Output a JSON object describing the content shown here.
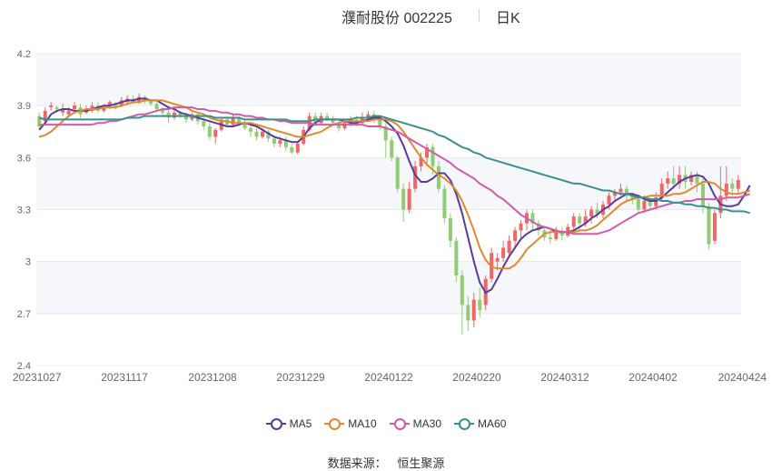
{
  "header": {
    "title": "濮耐股份 002225",
    "period": "日K"
  },
  "colors": {
    "up": "#ee6666",
    "down": "#91cc75",
    "grid_band": "#f5f7fb"
  },
  "chart_data": {
    "type": "candlestick",
    "y_ticks": [
      "4.2",
      "3.9",
      "3.6",
      "3.3",
      "3",
      "2.7",
      "2.4"
    ],
    "ylim": [
      2.4,
      4.2
    ],
    "x_ticks": [
      "20231027",
      "20231117",
      "20231208",
      "20231229",
      "20240122",
      "20240220",
      "20240312",
      "20240402",
      "20240424"
    ],
    "grid": true,
    "legend_position": "bottom",
    "series": [
      {
        "name": "MA5",
        "color": "#5a3a9e",
        "values": [
          3.76,
          3.8,
          3.85,
          3.87,
          3.88,
          3.88,
          3.87,
          3.87,
          3.87,
          3.88,
          3.89,
          3.9,
          3.9,
          3.91,
          3.92,
          3.93,
          3.93,
          3.94,
          3.94,
          3.93,
          3.93,
          3.91,
          3.89,
          3.88,
          3.86,
          3.85,
          3.84,
          3.83,
          3.82,
          3.81,
          3.8,
          3.79,
          3.78,
          3.78,
          3.79,
          3.8,
          3.79,
          3.78,
          3.76,
          3.74,
          3.72,
          3.71,
          3.7,
          3.69,
          3.69,
          3.72,
          3.77,
          3.8,
          3.82,
          3.82,
          3.82,
          3.82,
          3.81,
          3.8,
          3.8,
          3.81,
          3.82,
          3.83,
          3.83,
          3.81,
          3.78,
          3.74,
          3.67,
          3.58,
          3.5,
          3.46,
          3.46,
          3.48,
          3.51,
          3.51,
          3.47,
          3.39,
          3.28,
          3.14,
          3.0,
          2.88,
          2.82,
          2.84,
          2.9,
          2.97,
          3.03,
          3.08,
          3.13,
          3.16,
          3.18,
          3.19,
          3.2,
          3.19,
          3.17,
          3.17,
          3.17,
          3.18,
          3.2,
          3.22,
          3.25,
          3.27,
          3.3,
          3.32,
          3.35,
          3.37,
          3.39,
          3.39,
          3.38,
          3.36,
          3.35,
          3.35,
          3.37,
          3.4,
          3.43,
          3.46,
          3.48,
          3.49,
          3.5,
          3.49,
          3.45,
          3.38,
          3.33,
          3.32,
          3.32,
          3.33,
          3.38,
          3.44
        ]
      },
      {
        "name": "MA10",
        "color": "#e08a2e",
        "values": [
          3.72,
          3.73,
          3.75,
          3.78,
          3.81,
          3.84,
          3.86,
          3.87,
          3.88,
          3.88,
          3.88,
          3.89,
          3.89,
          3.89,
          3.9,
          3.91,
          3.92,
          3.92,
          3.93,
          3.93,
          3.93,
          3.93,
          3.92,
          3.91,
          3.9,
          3.89,
          3.87,
          3.86,
          3.85,
          3.83,
          3.82,
          3.81,
          3.81,
          3.8,
          3.8,
          3.8,
          3.8,
          3.79,
          3.78,
          3.77,
          3.76,
          3.75,
          3.74,
          3.73,
          3.72,
          3.72,
          3.73,
          3.74,
          3.75,
          3.77,
          3.79,
          3.8,
          3.81,
          3.81,
          3.81,
          3.81,
          3.81,
          3.82,
          3.82,
          3.82,
          3.81,
          3.79,
          3.75,
          3.7,
          3.65,
          3.6,
          3.56,
          3.53,
          3.5,
          3.48,
          3.45,
          3.41,
          3.35,
          3.27,
          3.18,
          3.08,
          3.01,
          2.97,
          2.96,
          2.96,
          2.96,
          2.98,
          3.02,
          3.07,
          3.1,
          3.13,
          3.16,
          3.17,
          3.17,
          3.17,
          3.17,
          3.17,
          3.18,
          3.18,
          3.19,
          3.21,
          3.24,
          3.27,
          3.3,
          3.33,
          3.35,
          3.36,
          3.37,
          3.37,
          3.38,
          3.38,
          3.38,
          3.38,
          3.39,
          3.39,
          3.4,
          3.42,
          3.44,
          3.46,
          3.46,
          3.45,
          3.42,
          3.4,
          3.39,
          3.39,
          3.4,
          3.41
        ]
      },
      {
        "name": "MA30",
        "color": "#d45aa8",
        "values": [
          3.79,
          3.79,
          3.79,
          3.79,
          3.79,
          3.79,
          3.79,
          3.79,
          3.79,
          3.79,
          3.8,
          3.8,
          3.81,
          3.81,
          3.82,
          3.83,
          3.84,
          3.85,
          3.85,
          3.86,
          3.87,
          3.88,
          3.88,
          3.89,
          3.89,
          3.89,
          3.89,
          3.88,
          3.88,
          3.87,
          3.87,
          3.86,
          3.86,
          3.85,
          3.85,
          3.84,
          3.84,
          3.83,
          3.83,
          3.82,
          3.82,
          3.81,
          3.81,
          3.8,
          3.8,
          3.8,
          3.8,
          3.79,
          3.79,
          3.79,
          3.79,
          3.79,
          3.79,
          3.79,
          3.79,
          3.79,
          3.78,
          3.78,
          3.78,
          3.77,
          3.76,
          3.75,
          3.73,
          3.71,
          3.69,
          3.67,
          3.65,
          3.63,
          3.61,
          3.59,
          3.57,
          3.54,
          3.52,
          3.5,
          3.48,
          3.45,
          3.43,
          3.41,
          3.38,
          3.36,
          3.33,
          3.3,
          3.27,
          3.25,
          3.23,
          3.21,
          3.2,
          3.19,
          3.18,
          3.17,
          3.17,
          3.16,
          3.16,
          3.16,
          3.16,
          3.16,
          3.17,
          3.18,
          3.2,
          3.22,
          3.24,
          3.26,
          3.28,
          3.29,
          3.3,
          3.31,
          3.32,
          3.33,
          3.34,
          3.34,
          3.35,
          3.35,
          3.36,
          3.36,
          3.36,
          3.36,
          3.36,
          3.37,
          3.37,
          3.37,
          3.38,
          3.39
        ]
      },
      {
        "name": "MA60",
        "color": "#3a9090",
        "values": [
          3.83,
          3.82,
          3.82,
          3.82,
          3.82,
          3.82,
          3.82,
          3.82,
          3.82,
          3.82,
          3.82,
          3.82,
          3.82,
          3.82,
          3.82,
          3.83,
          3.83,
          3.83,
          3.84,
          3.84,
          3.84,
          3.84,
          3.84,
          3.84,
          3.84,
          3.84,
          3.84,
          3.84,
          3.84,
          3.84,
          3.83,
          3.83,
          3.83,
          3.83,
          3.83,
          3.82,
          3.82,
          3.82,
          3.82,
          3.82,
          3.82,
          3.82,
          3.82,
          3.81,
          3.81,
          3.81,
          3.81,
          3.82,
          3.82,
          3.82,
          3.82,
          3.82,
          3.82,
          3.82,
          3.83,
          3.83,
          3.83,
          3.84,
          3.84,
          3.83,
          3.82,
          3.81,
          3.8,
          3.79,
          3.78,
          3.77,
          3.76,
          3.75,
          3.73,
          3.72,
          3.7,
          3.68,
          3.66,
          3.65,
          3.63,
          3.62,
          3.6,
          3.59,
          3.58,
          3.57,
          3.56,
          3.55,
          3.54,
          3.53,
          3.52,
          3.51,
          3.5,
          3.49,
          3.48,
          3.47,
          3.46,
          3.45,
          3.45,
          3.44,
          3.43,
          3.42,
          3.41,
          3.41,
          3.4,
          3.39,
          3.39,
          3.38,
          3.37,
          3.37,
          3.36,
          3.36,
          3.35,
          3.35,
          3.34,
          3.34,
          3.33,
          3.33,
          3.32,
          3.32,
          3.31,
          3.31,
          3.3,
          3.3,
          3.29,
          3.29,
          3.29,
          3.28
        ]
      }
    ],
    "candles": [
      [
        3.84,
        3.78,
        3.76,
        3.86
      ],
      [
        3.81,
        3.87,
        3.79,
        3.89
      ],
      [
        3.89,
        3.9,
        3.87,
        3.92
      ],
      [
        3.89,
        3.88,
        3.86,
        3.9
      ],
      [
        3.86,
        3.88,
        3.84,
        3.91
      ],
      [
        3.85,
        3.87,
        3.83,
        3.89
      ],
      [
        3.88,
        3.9,
        3.86,
        3.92
      ],
      [
        3.89,
        3.85,
        3.83,
        3.91
      ],
      [
        3.86,
        3.88,
        3.85,
        3.9
      ],
      [
        3.87,
        3.9,
        3.86,
        3.92
      ],
      [
        3.9,
        3.87,
        3.86,
        3.92
      ],
      [
        3.87,
        3.9,
        3.86,
        3.91
      ],
      [
        3.9,
        3.92,
        3.88,
        3.93
      ],
      [
        3.91,
        3.89,
        3.88,
        3.92
      ],
      [
        3.9,
        3.93,
        3.89,
        3.95
      ],
      [
        3.92,
        3.94,
        3.91,
        3.96
      ],
      [
        3.94,
        3.92,
        3.91,
        3.96
      ],
      [
        3.92,
        3.95,
        3.91,
        3.97
      ],
      [
        3.95,
        3.93,
        3.91,
        3.96
      ],
      [
        3.93,
        3.91,
        3.9,
        3.94
      ],
      [
        3.91,
        3.88,
        3.87,
        3.92
      ],
      [
        3.88,
        3.86,
        3.84,
        3.89
      ],
      [
        3.86,
        3.83,
        3.8,
        3.87
      ],
      [
        3.83,
        3.86,
        3.82,
        3.88
      ],
      [
        3.86,
        3.84,
        3.83,
        3.87
      ],
      [
        3.84,
        3.82,
        3.8,
        3.86
      ],
      [
        3.82,
        3.85,
        3.81,
        3.86
      ],
      [
        3.85,
        3.81,
        3.79,
        3.86
      ],
      [
        3.81,
        3.78,
        3.76,
        3.83
      ],
      [
        3.78,
        3.72,
        3.7,
        3.8
      ],
      [
        3.72,
        3.76,
        3.68,
        3.77
      ],
      [
        3.76,
        3.82,
        3.75,
        3.83
      ],
      [
        3.82,
        3.79,
        3.78,
        3.84
      ],
      [
        3.79,
        3.83,
        3.78,
        3.85
      ],
      [
        3.83,
        3.8,
        3.78,
        3.84
      ],
      [
        3.8,
        3.77,
        3.76,
        3.82
      ],
      [
        3.77,
        3.75,
        3.72,
        3.79
      ],
      [
        3.75,
        3.72,
        3.7,
        3.77
      ],
      [
        3.72,
        3.75,
        3.71,
        3.77
      ],
      [
        3.75,
        3.71,
        3.69,
        3.76
      ],
      [
        3.71,
        3.68,
        3.66,
        3.73
      ],
      [
        3.68,
        3.7,
        3.66,
        3.72
      ],
      [
        3.7,
        3.66,
        3.64,
        3.72
      ],
      [
        3.66,
        3.63,
        3.62,
        3.68
      ],
      [
        3.63,
        3.68,
        3.62,
        3.69
      ],
      [
        3.68,
        3.76,
        3.67,
        3.78
      ],
      [
        3.76,
        3.84,
        3.75,
        3.86
      ],
      [
        3.84,
        3.8,
        3.78,
        3.86
      ],
      [
        3.8,
        3.84,
        3.79,
        3.86
      ],
      [
        3.84,
        3.82,
        3.81,
        3.86
      ],
      [
        3.82,
        3.8,
        3.79,
        3.84
      ],
      [
        3.8,
        3.77,
        3.75,
        3.82
      ],
      [
        3.77,
        3.8,
        3.76,
        3.82
      ],
      [
        3.8,
        3.82,
        3.78,
        3.84
      ],
      [
        3.82,
        3.8,
        3.78,
        3.84
      ],
      [
        3.8,
        3.83,
        3.79,
        3.86
      ],
      [
        3.83,
        3.85,
        3.81,
        3.87
      ],
      [
        3.85,
        3.82,
        3.8,
        3.87
      ],
      [
        3.82,
        3.78,
        3.76,
        3.84
      ],
      [
        3.78,
        3.7,
        3.6,
        3.8
      ],
      [
        3.7,
        3.6,
        3.58,
        3.72
      ],
      [
        3.6,
        3.42,
        3.4,
        3.61
      ],
      [
        3.42,
        3.3,
        3.23,
        3.45
      ],
      [
        3.3,
        3.42,
        3.28,
        3.46
      ],
      [
        3.42,
        3.55,
        3.4,
        3.58
      ],
      [
        3.55,
        3.6,
        3.52,
        3.63
      ],
      [
        3.6,
        3.66,
        3.55,
        3.68
      ],
      [
        3.66,
        3.55,
        3.5,
        3.68
      ],
      [
        3.55,
        3.42,
        3.4,
        3.58
      ],
      [
        3.42,
        3.25,
        3.22,
        3.44
      ],
      [
        3.25,
        3.12,
        3.08,
        3.28
      ],
      [
        3.12,
        2.92,
        2.88,
        3.14
      ],
      [
        2.92,
        2.75,
        2.58,
        2.95
      ],
      [
        2.75,
        2.66,
        2.6,
        2.8
      ],
      [
        2.66,
        2.78,
        2.62,
        2.82
      ],
      [
        2.78,
        2.72,
        2.68,
        2.85
      ],
      [
        2.75,
        2.9,
        2.72,
        2.92
      ],
      [
        2.9,
        3.05,
        2.88,
        3.08
      ],
      [
        3.0,
        3.02,
        2.95,
        3.05
      ],
      [
        3.02,
        3.08,
        3.0,
        3.12
      ],
      [
        3.05,
        3.12,
        3.02,
        3.15
      ],
      [
        3.12,
        3.18,
        3.08,
        3.2
      ],
      [
        3.18,
        3.22,
        3.12,
        3.24
      ],
      [
        3.22,
        3.28,
        3.18,
        3.3
      ],
      [
        3.28,
        3.22,
        3.18,
        3.3
      ],
      [
        3.22,
        3.18,
        3.15,
        3.24
      ],
      [
        3.18,
        3.14,
        3.12,
        3.2
      ],
      [
        3.14,
        3.13,
        3.1,
        3.18
      ],
      [
        3.13,
        3.18,
        3.12,
        3.2
      ],
      [
        3.18,
        3.15,
        3.12,
        3.2
      ],
      [
        3.15,
        3.2,
        3.14,
        3.22
      ],
      [
        3.2,
        3.26,
        3.18,
        3.28
      ],
      [
        3.26,
        3.22,
        3.18,
        3.28
      ],
      [
        3.22,
        3.26,
        3.2,
        3.3
      ],
      [
        3.26,
        3.3,
        3.22,
        3.32
      ],
      [
        3.3,
        3.27,
        3.25,
        3.34
      ],
      [
        3.27,
        3.33,
        3.25,
        3.35
      ],
      [
        3.33,
        3.38,
        3.3,
        3.4
      ],
      [
        3.38,
        3.4,
        3.35,
        3.42
      ],
      [
        3.4,
        3.42,
        3.38,
        3.45
      ],
      [
        3.42,
        3.38,
        3.35,
        3.44
      ],
      [
        3.38,
        3.36,
        3.33,
        3.4
      ],
      [
        3.36,
        3.3,
        3.28,
        3.38
      ],
      [
        3.3,
        3.35,
        3.28,
        3.38
      ],
      [
        3.35,
        3.32,
        3.3,
        3.37
      ],
      [
        3.32,
        3.37,
        3.3,
        3.4
      ],
      [
        3.37,
        3.45,
        3.35,
        3.48
      ],
      [
        3.45,
        3.48,
        3.42,
        3.52
      ],
      [
        3.48,
        3.45,
        3.42,
        3.55
      ],
      [
        3.45,
        3.5,
        3.42,
        3.55
      ],
      [
        3.5,
        3.46,
        3.42,
        3.55
      ],
      [
        3.46,
        3.5,
        3.44,
        3.52
      ],
      [
        3.5,
        3.45,
        3.4,
        3.52
      ],
      [
        3.45,
        3.32,
        3.28,
        3.48
      ],
      [
        3.32,
        3.1,
        3.07,
        3.34
      ],
      [
        3.12,
        3.28,
        3.1,
        3.3
      ],
      [
        3.28,
        3.38,
        3.25,
        3.55
      ],
      [
        3.38,
        3.45,
        3.35,
        3.55
      ],
      [
        3.45,
        3.42,
        3.38,
        3.48
      ],
      [
        3.42,
        3.47,
        3.4,
        3.5
      ]
    ]
  },
  "legend": [
    {
      "label": "MA5",
      "color": "#5a3a9e"
    },
    {
      "label": "MA10",
      "color": "#e08a2e"
    },
    {
      "label": "MA30",
      "color": "#d45aa8"
    },
    {
      "label": "MA60",
      "color": "#3a9090"
    }
  ],
  "source": {
    "label": "数据来源：",
    "value": "恒生聚源"
  }
}
